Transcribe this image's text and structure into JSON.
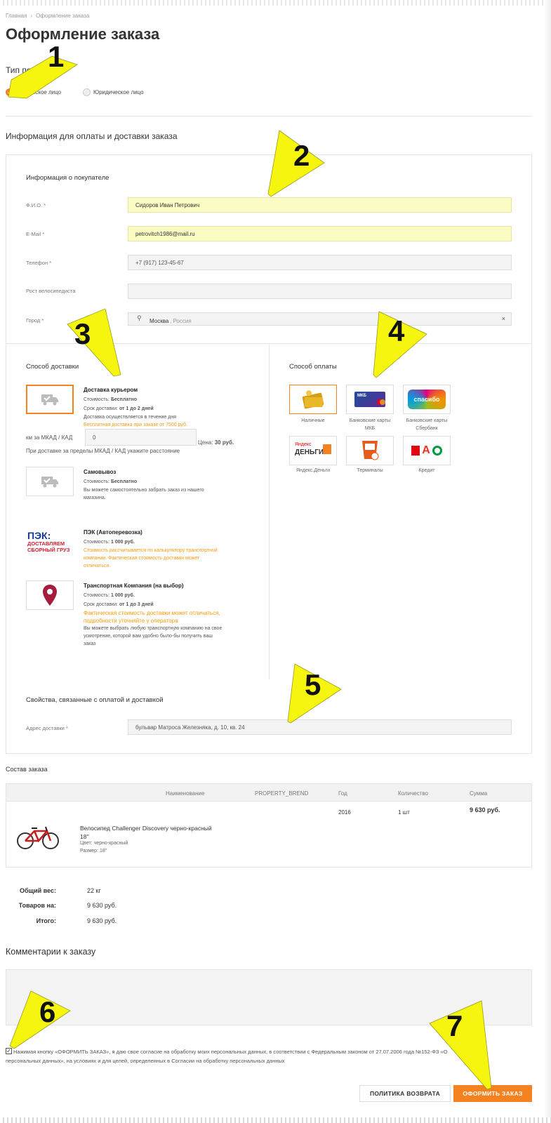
{
  "breadcrumb": [
    "Главная",
    "Оформление заказа"
  ],
  "page_title": "Оформление заказа",
  "buyer_type": {
    "title": "Тип покупателя",
    "options": [
      {
        "label": "Физическое лицо",
        "selected": true
      },
      {
        "label": "Юридическое лицо",
        "selected": false
      }
    ]
  },
  "info_section_title": "Информация для оплаты и доставки заказа",
  "buyer_info": {
    "title": "Информация о покупателе",
    "fields": [
      {
        "label": "Ф.И.О.",
        "required": "*",
        "value": "Сидоров Иван Петрович"
      },
      {
        "label": "E-Mail",
        "required": "*",
        "value": "petrovitch1986@mail.ru"
      },
      {
        "label": "Телефон",
        "required": "*",
        "value": "+7 (917) 123-45-67"
      },
      {
        "label": "Рост велосипедиста",
        "required": "",
        "value": ""
      },
      {
        "label": "Город",
        "required": "*",
        "value": "Москва",
        "value_extra": ", Россия"
      }
    ]
  },
  "delivery": {
    "title": "Способ доставки",
    "courier": {
      "name": "Доставка курьером",
      "cost_label": "Стоимость:",
      "cost": "Бесплатно",
      "term_label": "Срок доставки:",
      "term": "от 1 до 2 дней",
      "note": "Доставка осуществляется в течение дня",
      "promo": "Бесплатная доставка при заказе от 7500 руб.",
      "km_label": "км за МКАД / КАД",
      "km_value": "0",
      "price_label": "Цена:",
      "price": "30 руб.",
      "km_hint": "При доставке за пределы МКАД / КАД укажите расстояние"
    },
    "pickup": {
      "name": "Самовывоз",
      "cost_label": "Стоимость:",
      "cost": "Бесплатно",
      "note1": "Вы можете самостоятельно забрать заказ из нашего",
      "note2": "магазина."
    },
    "pek": {
      "name": "ПЭК (Автоперевозка)",
      "logo_top": "ПЭК:",
      "logo_line1": "ДОСТАВЛЯЕМ",
      "logo_line2": "СБОРНЫЙ ГРУЗ",
      "cost_label": "Стоимость:",
      "cost": "1 000 руб.",
      "warn1": "Стоимость рассчитывается по калькулятору транспортной",
      "warn2": "компании. Фактическая стоимость доставки может",
      "warn3": "отличаться."
    },
    "transport": {
      "name": "Транспортная Компания (на выбор)",
      "cost_label": "Стоимость:",
      "cost": "1 000 руб.",
      "term_label": "Срок доставки:",
      "term": "от 1 до 3 дней",
      "warn1": "Фактическая стоимость доставки может отличаться,",
      "warn2": "подробности уточняйте у оператора",
      "note1": "Вы можете выбрать любую транспортную компанию на свое",
      "note2": "усмотрение, которой вам удобно было-бы получить ваш",
      "note3": "заказ"
    }
  },
  "payment": {
    "title": "Способ оплаты",
    "options": [
      {
        "label1": "Наличные",
        "label2": ""
      },
      {
        "label1": "Банковские карты",
        "label2": "МКБ"
      },
      {
        "label1": "Банковские карты",
        "label2": "Сбербанк"
      },
      {
        "label1": "Яндекс.Деньги",
        "label2": ""
      },
      {
        "label1": "Терминалы",
        "label2": ""
      },
      {
        "label1": "Кредит",
        "label2": ""
      }
    ],
    "logo_text": {
      "mkb": "МКБ",
      "spasibo": "спасибо",
      "yandex1": "Яндекс",
      "yandex2": "ДЕНЬГИ",
      "credit": "А"
    }
  },
  "properties": {
    "title": "Свойства, связанные с оплатой и доставкой",
    "address_label": "Адрес доставки",
    "required": "*",
    "address_value": "бульвар Матроса Железняка, д. 10, кв. 24"
  },
  "order": {
    "title": "Состав заказа",
    "columns": [
      "Наименование",
      "PROPERTY_BREND",
      "Год",
      "Количество",
      "Сумма"
    ],
    "items": [
      {
        "name": "Велосипед Challenger Discovery черно-красный",
        "size_line": "18''",
        "color_label": "Цвет:",
        "color": "черно-красный",
        "size_label": "Размер:",
        "size": "18''",
        "year": "2016",
        "qty": "1 шт",
        "sum": "9 630 руб."
      }
    ]
  },
  "totals": [
    {
      "label": "Общий вес:",
      "value": "22 кг"
    },
    {
      "label": "Товаров на:",
      "value": "9 630 руб."
    },
    {
      "label": "Итого:",
      "value": "9 630 руб."
    }
  ],
  "comments_title": "Комментарии к заказу",
  "consent": {
    "checked": true,
    "line1": "Нажимая кнопку «ОФОРМИТЬ ЗАКАЗ», я даю свое согласие на обработку моих персональных данных, в соответствии с Федеральным законом от 27.07.2006 года №152-ФЗ «О",
    "line2": "персональных данных», на условиях и для целей, определенных в Согласии на обработку персональных данных"
  },
  "buttons": {
    "return_policy": "ПОЛИТИКА ВОЗВРАТА",
    "checkout": "ОФОРМИТЬ ЗАКАЗ"
  },
  "annotations": [
    "1",
    "2",
    "3",
    "4",
    "5",
    "6",
    "7"
  ],
  "colors": {
    "accent": "#f58220",
    "arrow": "#f5f510",
    "warn": "#f59a10",
    "highlight": "#fbfcc4"
  }
}
